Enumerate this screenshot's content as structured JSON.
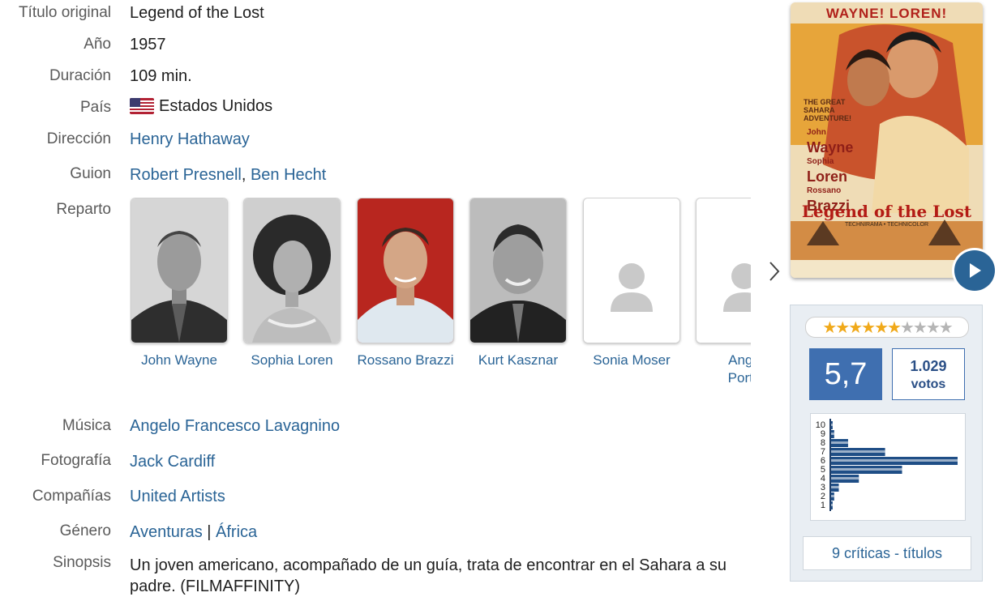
{
  "labels": {
    "original_title": "Título original",
    "year": "Año",
    "duration": "Duración",
    "country": "País",
    "direction": "Dirección",
    "script": "Guion",
    "cast": "Reparto",
    "music": "Música",
    "photography": "Fotografía",
    "companies": "Compañías",
    "genre": "Género",
    "synopsis": "Sinopsis"
  },
  "values": {
    "original_title": "Legend of the Lost",
    "year": "1957",
    "duration": "109 min.",
    "country": "Estados Unidos",
    "director": "Henry Hathaway",
    "writers": [
      "Robert Presnell",
      "Ben Hecht"
    ],
    "music": "Angelo Francesco Lavagnino",
    "photography": "Jack Cardiff",
    "companies": "United Artists",
    "genres": [
      "Aventuras",
      "África"
    ],
    "genre_separator": "|",
    "synopsis_line1": "Un joven americano, acompañado de un guía, trata de encontrar en el Sahara a su",
    "synopsis_line2": "padre. (FILMAFFINITY)"
  },
  "cast": [
    {
      "name": "John Wayne",
      "name2": "",
      "photo": "bw-portrait"
    },
    {
      "name": "Sophia Loren",
      "name2": "",
      "photo": "bw-portrait"
    },
    {
      "name": "Rossano Brazzi",
      "name2": "",
      "photo": "color-portrait"
    },
    {
      "name": "Kurt Kasznar",
      "name2": "",
      "photo": "bw-portrait"
    },
    {
      "name": "Sonia Moser",
      "name2": "",
      "photo": "placeholder-person-icon"
    },
    {
      "name": "Ange",
      "name2": "Porta",
      "photo": "placeholder-person-icon"
    }
  ],
  "poster": {
    "top_text": "WAYNE! LOREN!",
    "tagline": "THE GREAT SAHARA ADVENTURE!",
    "credits": [
      "John",
      "Wayne",
      "Sophia",
      "Loren",
      "Rossano",
      "Brazzi"
    ],
    "title": "Legend of the Lost",
    "footer": "TECHNIRAMA • TECHNICOLOR"
  },
  "rating": {
    "score": "5,7",
    "votes_count": "1.029",
    "votes_label": "votos",
    "stars_filled": 5.7,
    "stars_total": 10,
    "histogram": {
      "levels": [
        "10",
        "9",
        "8",
        "7",
        "6",
        "5",
        "4",
        "3",
        "2",
        "1"
      ],
      "values": [
        1,
        2,
        11,
        35,
        82,
        46,
        18,
        5,
        2,
        1
      ]
    },
    "critics_label": "9 críticas - títulos"
  },
  "colors": {
    "link": "#2a6496",
    "score_bg": "#3f6fb0",
    "star_filled": "#f0a91a",
    "star_empty": "#b5b5b5",
    "hist_bar": "#1f4e86"
  }
}
